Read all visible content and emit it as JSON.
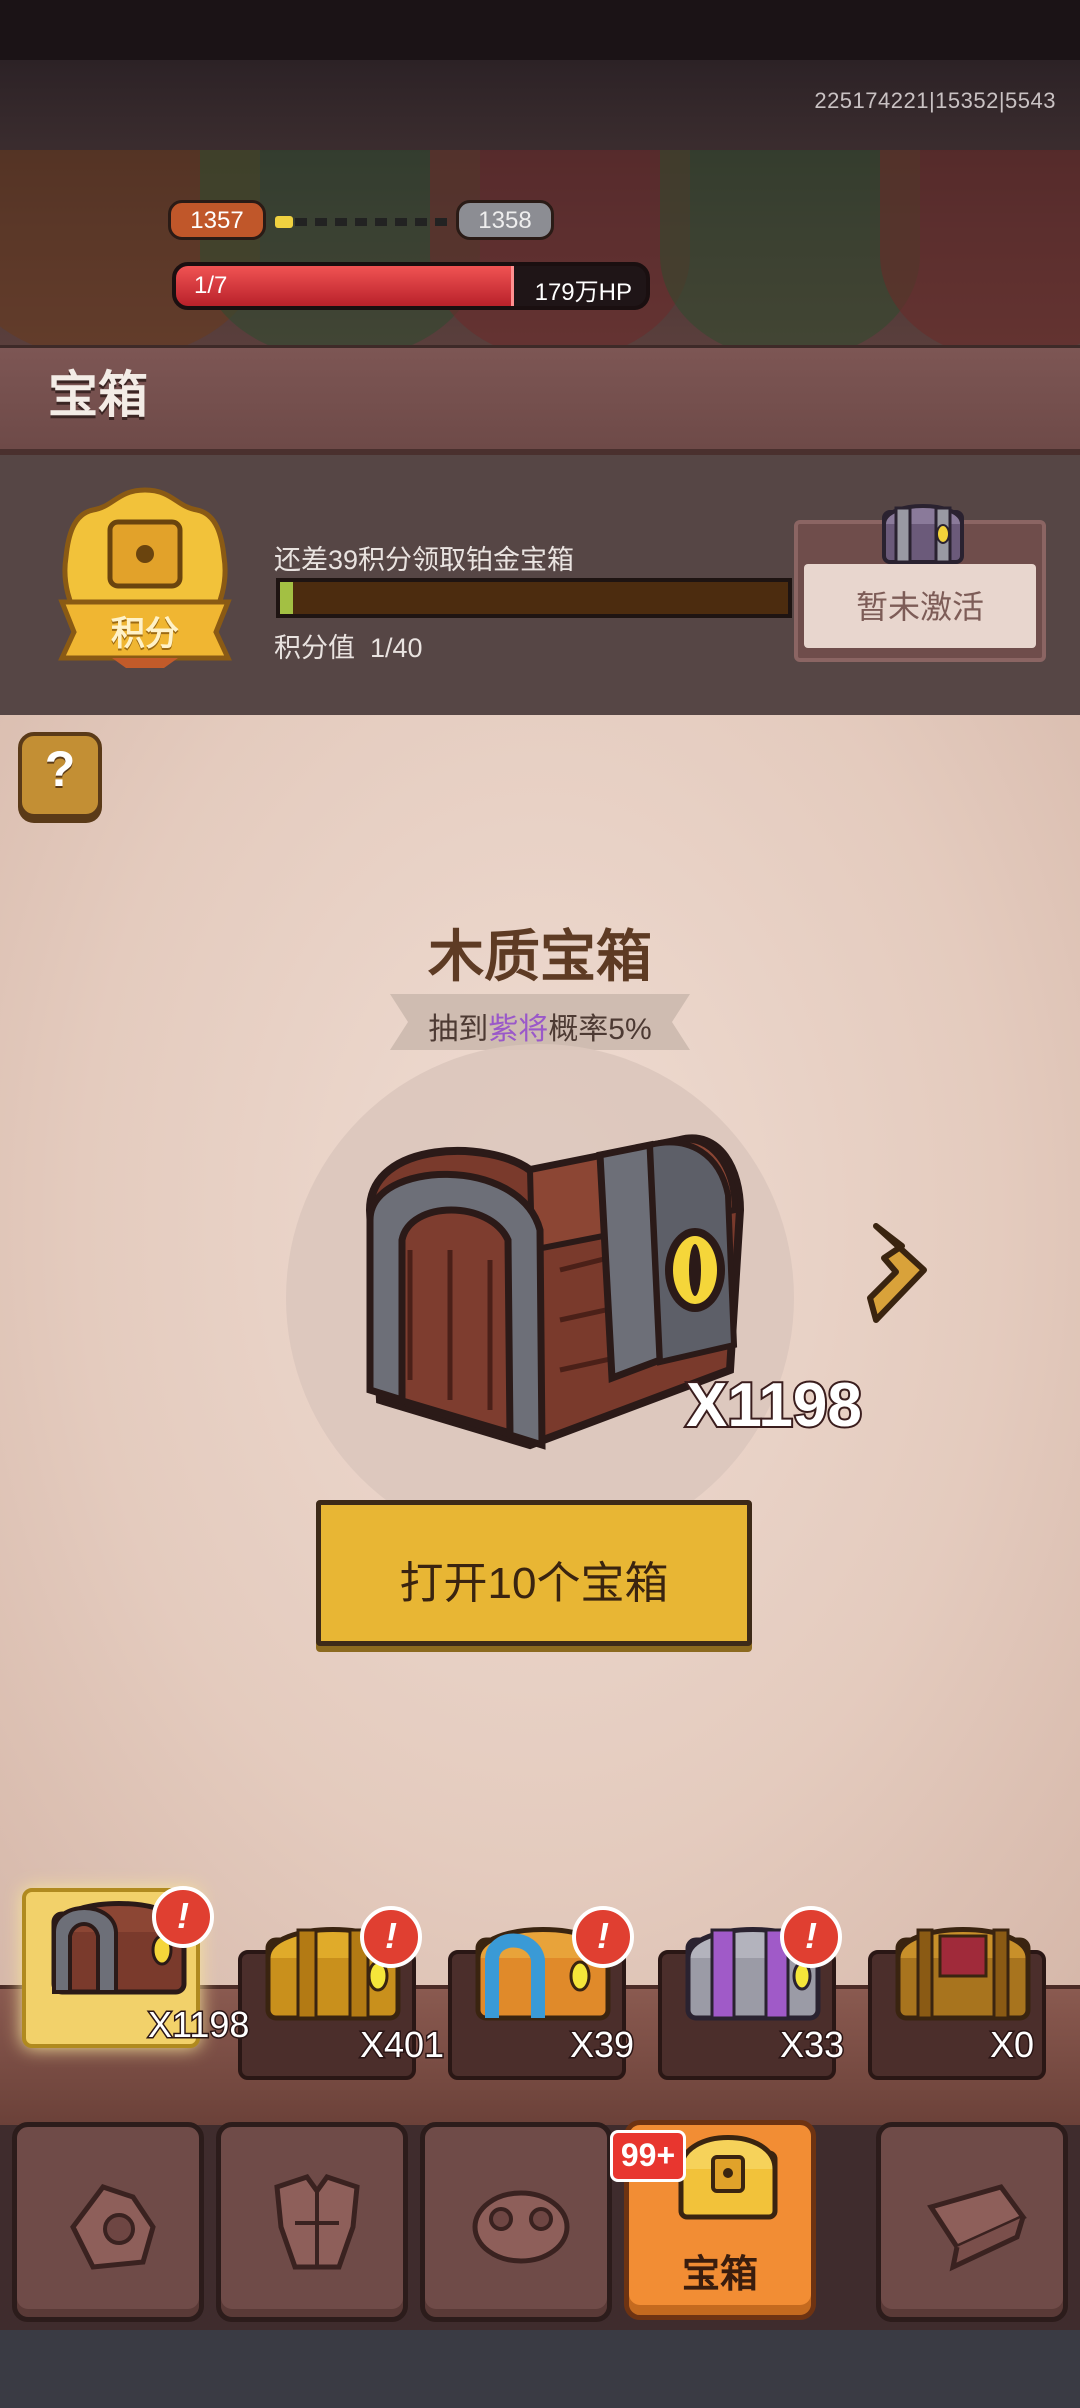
{
  "status": {
    "server_id": "225174221|15352|5543"
  },
  "boss": {
    "level_current": "1357",
    "level_next": "1358",
    "stage": "1/7",
    "hp_text": "179万HP",
    "hp_fill": 0.72
  },
  "header": {
    "title": "宝箱"
  },
  "points": {
    "badge_label": "积分",
    "progress_text": "还差39积分领取铂金宝箱",
    "value_label": "积分值",
    "value": "1/40",
    "progress": 0.025,
    "inactive_label": "暂未激活"
  },
  "help": {
    "label": "?"
  },
  "chest": {
    "name": "木质宝箱",
    "sub_prefix": "抽到",
    "sub_highlight": "紫将",
    "sub_suffix": "概率5%",
    "count": "X1198",
    "open_label": "打开10个宝箱"
  },
  "tray": [
    {
      "count": "X1198",
      "badge": "!",
      "selected": true,
      "kind": "wood"
    },
    {
      "count": "X401",
      "badge": "!",
      "selected": false,
      "kind": "gold"
    },
    {
      "count": "X39",
      "badge": "!",
      "selected": false,
      "kind": "blue"
    },
    {
      "count": "X33",
      "badge": "!",
      "selected": false,
      "kind": "purple"
    },
    {
      "count": "X0",
      "badge": "",
      "selected": false,
      "kind": "royal"
    }
  ],
  "nav": {
    "badge": "99+",
    "chest_label": "宝箱"
  },
  "colors": {
    "accent": "#f28d34",
    "button": "#e8b634",
    "hp": "#e23a3f",
    "highlight": "#9a58c9"
  }
}
